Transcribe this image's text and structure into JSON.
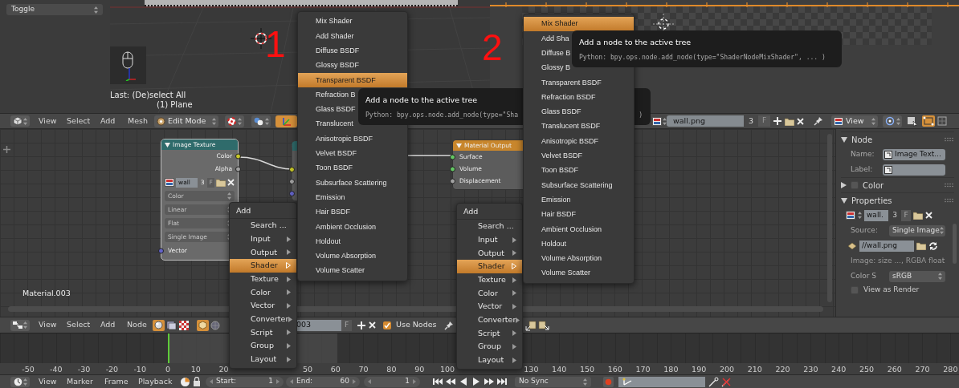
{
  "tool_shelf": {
    "toggle_field": "Toggle"
  },
  "viewport": {
    "last_operator": "Last: (De)select All",
    "object_info": "(1) Plane"
  },
  "annotations": [
    "1",
    "2"
  ],
  "view3d_header": {
    "menus": [
      "View",
      "Select",
      "Add",
      "Mesh"
    ],
    "mode": "Edit Mode"
  },
  "image_header": {
    "image": "wall.png",
    "users": "3",
    "fake": "F",
    "view": "View"
  },
  "node_editor": {
    "nodes": [
      {
        "kind": "image_texture",
        "title": "Image Texture",
        "outputs": [
          {
            "label": "Color",
            "color": "#c7c729"
          },
          {
            "label": "Alpha",
            "color": "#a1a1a1"
          }
        ],
        "image": "wall",
        "users": "3",
        "fake": "F",
        "dropdowns": [
          "Color",
          "Linear",
          "Flat",
          "Single Image"
        ],
        "inputs": [
          {
            "label": "Vector",
            "color": "#6363c7"
          }
        ]
      },
      {
        "kind": "partial",
        "inputs": [
          {
            "color": "#c7c729"
          },
          {
            "color": "#a1a1a1"
          },
          {
            "color": "#6363c7"
          }
        ]
      },
      {
        "kind": "output",
        "title": "Material Output",
        "inputs": [
          {
            "label": "Surface",
            "color": "#63c763"
          },
          {
            "label": "Volume",
            "color": "#63c763"
          },
          {
            "label": "Displacement",
            "color": "#a1a1a1"
          }
        ]
      }
    ],
    "material": "Material.003"
  },
  "properties_panel": {
    "sections": [
      {
        "kind": "node",
        "title": "Node",
        "expanded": true,
        "name_label": "Name:",
        "name_value": "Image Text...",
        "label_label": "Label:"
      },
      {
        "kind": "color",
        "title": "Color",
        "expanded": false,
        "checked": false
      },
      {
        "kind": "properties",
        "title": "Properties",
        "expanded": true,
        "image": "wall.",
        "users": "3",
        "fake": "F",
        "source_label": "Source:",
        "source": "Single Image",
        "filepath": "//wall.png",
        "info": "Image: size ..., RGBA float",
        "colorspace_label": "Color S",
        "colorspace": "sRGB",
        "view_as_render": {
          "label": "View as Render",
          "checked": false
        }
      }
    ]
  },
  "node_header": {
    "menus": [
      "View",
      "Select",
      "Add",
      "Node"
    ],
    "material": "003",
    "fake": "F",
    "use_nodes": {
      "label": "Use Nodes",
      "checked": true
    }
  },
  "timeline": {
    "tick_groups": [
      [
        "-50",
        "-40",
        "-30",
        "-20",
        "-10",
        "0",
        "10",
        "20"
      ],
      [
        "50",
        "60",
        "70",
        "80",
        "90",
        "100"
      ],
      [
        "130",
        "140",
        "150",
        "160",
        "170",
        "180",
        "190",
        "200",
        "210",
        "220",
        "230",
        "240",
        "250",
        "260",
        "270",
        "280"
      ]
    ]
  },
  "timeline_header": {
    "menus": [
      "View",
      "Marker",
      "Frame",
      "Playback"
    ],
    "start_label": "Start:",
    "start": "1",
    "end_label": "End:",
    "end": "60",
    "current": "1",
    "sync": "No Sync"
  },
  "menus": [
    {
      "add_menu": {
        "title": "Add",
        "items": [
          {
            "label": "Search ...",
            "submenu": false,
            "selected": false
          },
          {
            "label": "Input",
            "submenu": true,
            "selected": false
          },
          {
            "label": "Output",
            "submenu": true,
            "selected": false
          },
          {
            "label": "Shader",
            "submenu": true,
            "selected": true
          },
          {
            "label": "Texture",
            "submenu": true,
            "selected": false
          },
          {
            "label": "Color",
            "submenu": true,
            "selected": false
          },
          {
            "label": "Vector",
            "submenu": true,
            "selected": false
          },
          {
            "label": "Converter",
            "submenu": true,
            "selected": false
          },
          {
            "label": "Script",
            "submenu": true,
            "selected": false
          },
          {
            "label": "Group",
            "submenu": true,
            "selected": false
          },
          {
            "label": "Layout",
            "submenu": true,
            "selected": false
          }
        ]
      },
      "shader_menu": {
        "items": [
          {
            "label": "Mix Shader",
            "selected": false
          },
          {
            "label": "Add Shader",
            "selected": false
          },
          {
            "label": "Diffuse BSDF",
            "selected": false
          },
          {
            "label": "Glossy BSDF",
            "selected": false
          },
          {
            "label": "Transparent BSDF",
            "selected": true
          },
          {
            "label": "Refraction B",
            "selected": false
          },
          {
            "label": "Glass BSDF",
            "selected": false
          },
          {
            "label": "Translucent",
            "selected": false
          },
          {
            "label": "Anisotropic BSDF",
            "selected": false
          },
          {
            "label": "Velvet BSDF",
            "selected": false
          },
          {
            "label": "Toon BSDF",
            "selected": false
          },
          {
            "label": "Subsurface Scattering",
            "selected": false
          },
          {
            "label": "Emission",
            "selected": false
          },
          {
            "label": "Hair BSDF",
            "selected": false
          },
          {
            "label": "Ambient Occlusion",
            "selected": false
          },
          {
            "label": "Holdout",
            "selected": false
          },
          {
            "label": "Volume Absorption",
            "selected": false
          },
          {
            "label": "Volume Scatter",
            "selected": false
          }
        ]
      },
      "tooltip": {
        "title": "Add a node to the active tree",
        "python": "Python: bpy.ops.node.add_node(type=\"Sha",
        "tail": ")"
      }
    },
    {
      "add_menu": {
        "title": "Add",
        "items": [
          {
            "label": "Search ...",
            "submenu": false,
            "selected": false
          },
          {
            "label": "Input",
            "submenu": true,
            "selected": false
          },
          {
            "label": "Output",
            "submenu": true,
            "selected": false
          },
          {
            "label": "Shader",
            "submenu": true,
            "selected": true
          },
          {
            "label": "Texture",
            "submenu": true,
            "selected": false
          },
          {
            "label": "Color",
            "submenu": true,
            "selected": false
          },
          {
            "label": "Vector",
            "submenu": true,
            "selected": false
          },
          {
            "label": "Converter",
            "submenu": true,
            "selected": false
          },
          {
            "label": "Script",
            "submenu": true,
            "selected": false
          },
          {
            "label": "Group",
            "submenu": true,
            "selected": false
          },
          {
            "label": "Layout",
            "submenu": true,
            "selected": false
          }
        ]
      },
      "shader_menu": {
        "items": [
          {
            "label": "Mix Shader",
            "selected": true
          },
          {
            "label": "Add Sha",
            "selected": false
          },
          {
            "label": "Diffuse B",
            "selected": false
          },
          {
            "label": "Glossy B",
            "selected": false
          },
          {
            "label": "Transparent BSDF",
            "selected": false
          },
          {
            "label": "Refraction BSDF",
            "selected": false
          },
          {
            "label": "Glass BSDF",
            "selected": false
          },
          {
            "label": "Translucent BSDF",
            "selected": false
          },
          {
            "label": "Anisotropic BSDF",
            "selected": false
          },
          {
            "label": "Velvet BSDF",
            "selected": false
          },
          {
            "label": "Toon BSDF",
            "selected": false
          },
          {
            "label": "Subsurface Scattering",
            "selected": false
          },
          {
            "label": "Emission",
            "selected": false
          },
          {
            "label": "Hair BSDF",
            "selected": false
          },
          {
            "label": "Ambient Occlusion",
            "selected": false
          },
          {
            "label": "Holdout",
            "selected": false
          },
          {
            "label": "Volume Absorption",
            "selected": false
          },
          {
            "label": "Volume Scatter",
            "selected": false
          }
        ]
      },
      "tooltip": {
        "title": "Add a node to the active tree",
        "python": "Python: bpy.ops.node.add_node(type=\"ShaderNodeMixShader\", ... )"
      }
    }
  ]
}
